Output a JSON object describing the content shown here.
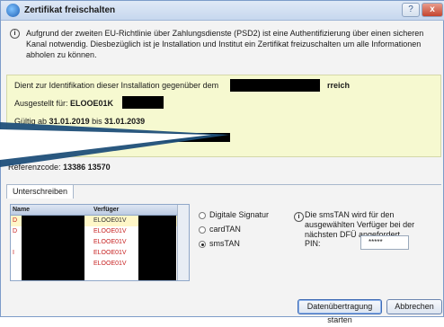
{
  "window": {
    "title": "Zertifikat freischalten",
    "help_glyph": "?",
    "close_glyph": "x"
  },
  "info": {
    "icon_glyph": "i",
    "text": "Aufgrund der zweiten EU-Richtlinie über Zahlungsdienste (PSD2) ist eine Authentifizierung über einen sicheren Kanal notwendig. Diesbezüglich ist je Installation und Institut ein Zertifikat freizuschalten um alle Informationen abholen zu können."
  },
  "cert": {
    "ident_prefix": "Dient zur Identifikation dieser Installation gegenüber dem",
    "ident_suffix": "rreich",
    "issued_label": "Ausgestellt für:",
    "issued_value": "ELOOE01K",
    "valid_prefix": "Gültig ab",
    "valid_from": "31.01.2019",
    "valid_mid": "bis",
    "valid_to": "31.01.2039"
  },
  "reference": {
    "label": "Referenzcode:",
    "value": "13386 13570"
  },
  "tabs": {
    "sign": "Unterschreiben"
  },
  "table": {
    "headers": [
      "Name",
      "Verfüger"
    ],
    "rows": [
      {
        "name": "D",
        "verfueger": "ELOOE01V"
      },
      {
        "name": "D",
        "verfueger": "ELOOE01V"
      },
      {
        "name": "",
        "verfueger": "ELOOE01V"
      },
      {
        "name": "I",
        "verfueger": "ELOOE01V"
      },
      {
        "name": "",
        "verfueger": "ELOOE01V"
      }
    ]
  },
  "methods": {
    "options": [
      "Digitale Signatur",
      "cardTAN",
      "smsTAN"
    ],
    "selected": "smsTAN"
  },
  "sms": {
    "notice": "Die smsTAN wird für den ausgewählten Verfüger bei der nächsten DFÜ angefordert.",
    "pin_label": "PIN:",
    "pin_value": "*****"
  },
  "buttons": {
    "start": "Datenübertragung starten",
    "cancel": "Abbrechen"
  },
  "colors": {
    "info_background": "#f6f9d0",
    "callout": "#1f4f7a",
    "disposer_text": "#c72222"
  }
}
